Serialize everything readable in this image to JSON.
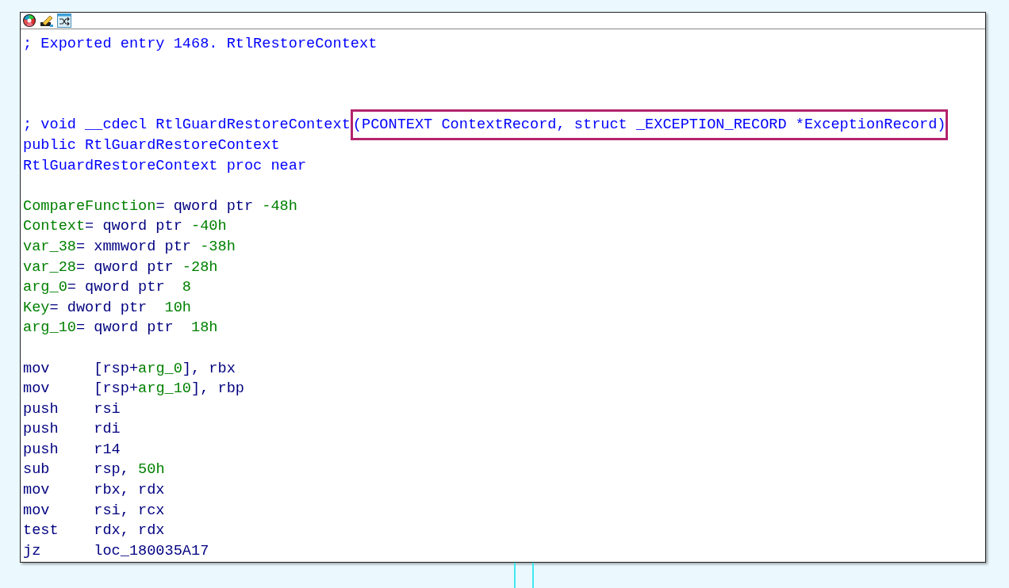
{
  "node": {
    "lines": [
      {
        "kind": "text",
        "segments": [
          {
            "kind": "comment",
            "text": "; Exported entry 1468. RtlRestoreContext"
          }
        ]
      },
      {
        "kind": "blank"
      },
      {
        "kind": "blank"
      },
      {
        "kind": "blank"
      },
      {
        "kind": "text",
        "segments": [
          {
            "kind": "comment",
            "text": "; void __cdecl RtlGuardRestoreContext"
          },
          {
            "kind": "comment",
            "text": "(PCONTEXT ContextRecord, struct _EXCEPTION_RECORD *ExceptionRecord)",
            "highlighted": true
          }
        ]
      },
      {
        "kind": "text",
        "segments": [
          {
            "kind": "name",
            "text": "public RtlGuardRestoreContext"
          }
        ]
      },
      {
        "kind": "text",
        "segments": [
          {
            "kind": "name",
            "text": "RtlGuardRestoreContext proc near"
          }
        ]
      },
      {
        "kind": "blank"
      },
      {
        "kind": "text",
        "segments": [
          {
            "kind": "var",
            "text": "CompareFunction"
          },
          {
            "kind": "plain",
            "text": "= qword ptr "
          },
          {
            "kind": "var",
            "text": "-48h"
          }
        ]
      },
      {
        "kind": "text",
        "segments": [
          {
            "kind": "var",
            "text": "Context"
          },
          {
            "kind": "plain",
            "text": "= qword ptr "
          },
          {
            "kind": "var",
            "text": "-40h"
          }
        ]
      },
      {
        "kind": "text",
        "segments": [
          {
            "kind": "var",
            "text": "var_38"
          },
          {
            "kind": "plain",
            "text": "= xmmword ptr "
          },
          {
            "kind": "var",
            "text": "-38h"
          }
        ]
      },
      {
        "kind": "text",
        "segments": [
          {
            "kind": "var",
            "text": "var_28"
          },
          {
            "kind": "plain",
            "text": "= qword ptr "
          },
          {
            "kind": "var",
            "text": "-28h"
          }
        ]
      },
      {
        "kind": "text",
        "segments": [
          {
            "kind": "var",
            "text": "arg_0"
          },
          {
            "kind": "plain",
            "text": "= qword ptr  "
          },
          {
            "kind": "var",
            "text": "8"
          }
        ]
      },
      {
        "kind": "text",
        "segments": [
          {
            "kind": "var",
            "text": "Key"
          },
          {
            "kind": "plain",
            "text": "= dword ptr  "
          },
          {
            "kind": "var",
            "text": "10h"
          }
        ]
      },
      {
        "kind": "text",
        "segments": [
          {
            "kind": "var",
            "text": "arg_10"
          },
          {
            "kind": "plain",
            "text": "= qword ptr  "
          },
          {
            "kind": "var",
            "text": "18h"
          }
        ]
      },
      {
        "kind": "blank"
      },
      {
        "kind": "text",
        "segments": [
          {
            "kind": "plain",
            "text": "mov     [rsp+"
          },
          {
            "kind": "var",
            "text": "arg_0"
          },
          {
            "kind": "plain",
            "text": "], rbx"
          }
        ]
      },
      {
        "kind": "text",
        "segments": [
          {
            "kind": "plain",
            "text": "mov     [rsp+"
          },
          {
            "kind": "var",
            "text": "arg_10"
          },
          {
            "kind": "plain",
            "text": "], rbp"
          }
        ]
      },
      {
        "kind": "text",
        "segments": [
          {
            "kind": "plain",
            "text": "push    rsi"
          }
        ]
      },
      {
        "kind": "text",
        "segments": [
          {
            "kind": "plain",
            "text": "push    rdi"
          }
        ]
      },
      {
        "kind": "text",
        "segments": [
          {
            "kind": "plain",
            "text": "push    r14"
          }
        ]
      },
      {
        "kind": "text",
        "segments": [
          {
            "kind": "plain",
            "text": "sub     rsp, "
          },
          {
            "kind": "var",
            "text": "50h"
          }
        ]
      },
      {
        "kind": "text",
        "segments": [
          {
            "kind": "plain",
            "text": "mov     rbx, rdx"
          }
        ]
      },
      {
        "kind": "text",
        "segments": [
          {
            "kind": "plain",
            "text": "mov     rsi, rcx"
          }
        ]
      },
      {
        "kind": "text",
        "segments": [
          {
            "kind": "plain",
            "text": "test    rdx, rdx"
          }
        ]
      },
      {
        "kind": "text",
        "segments": [
          {
            "kind": "plain",
            "text": "jz      loc_180035A17"
          }
        ]
      }
    ]
  }
}
